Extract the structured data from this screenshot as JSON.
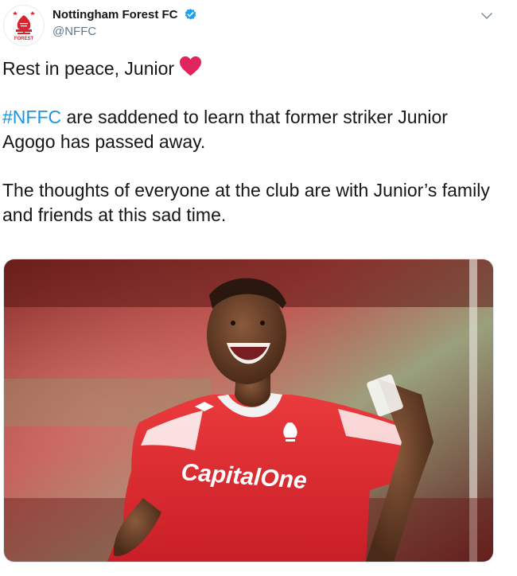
{
  "account": {
    "display_name": "Nottingham Forest FC",
    "handle": "@NFFC",
    "verified_icon": "verified-badge-icon",
    "avatar_icon": "nottingham-forest-crest-icon",
    "avatar_caption": "FOREST"
  },
  "menu": {
    "icon": "chevron-down-icon"
  },
  "tweet": {
    "line1": "Rest in peace, Junior",
    "line1_icon": "red-heart-icon",
    "hashtag": "#NFFC",
    "p2_rest": " are saddened to learn that former striker Junior Agogo has passed away.",
    "p3": "The thoughts of everyone at the club are with Junior’s family and friends at this sad time."
  },
  "media": {
    "kind": "photo",
    "sponsor_text": "CapitalOne",
    "kit_brand_icon": "umbro-logo-icon",
    "shirt_crest_icon": "forest-crest-icon"
  },
  "colors": {
    "link": "#1b95e0",
    "verified": "#1da1f2",
    "heart": "#e0245e",
    "kit_red": "#e0262d",
    "handle_gray": "#657786"
  }
}
